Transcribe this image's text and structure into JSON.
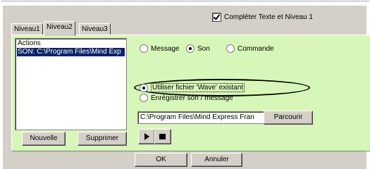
{
  "top_checkbox": {
    "label": "Compléter Texte et Niveau 1",
    "checked": true
  },
  "tabs": [
    {
      "label": "Niveau1",
      "active": false
    },
    {
      "label": "Niveau2",
      "active": true
    },
    {
      "label": "Niveau3",
      "active": false
    }
  ],
  "actions_list": {
    "header": "Actions",
    "items": [
      "SON: C:\\Program Files\\Mind Exp"
    ]
  },
  "list_buttons": {
    "new_label": "Nouvelle",
    "delete_label": "Supprimer"
  },
  "type_radios": [
    {
      "label": "Message",
      "selected": false
    },
    {
      "label": "Son",
      "selected": true
    },
    {
      "label": "Commande",
      "selected": false
    }
  ],
  "sound_radios": [
    {
      "label": "Utiliser fichier 'Wave' existant",
      "selected": true
    },
    {
      "label": "Enrégistrer son / message",
      "selected": false
    }
  ],
  "file": {
    "path_value": "C:\\Program Files\\Mind Express Fran",
    "browse_label": "Parcourir"
  },
  "player": {
    "play_icon": "play-icon",
    "stop_icon": "stop-icon"
  },
  "dialog_buttons": {
    "ok_label": "OK",
    "cancel_label": "Annuler"
  }
}
